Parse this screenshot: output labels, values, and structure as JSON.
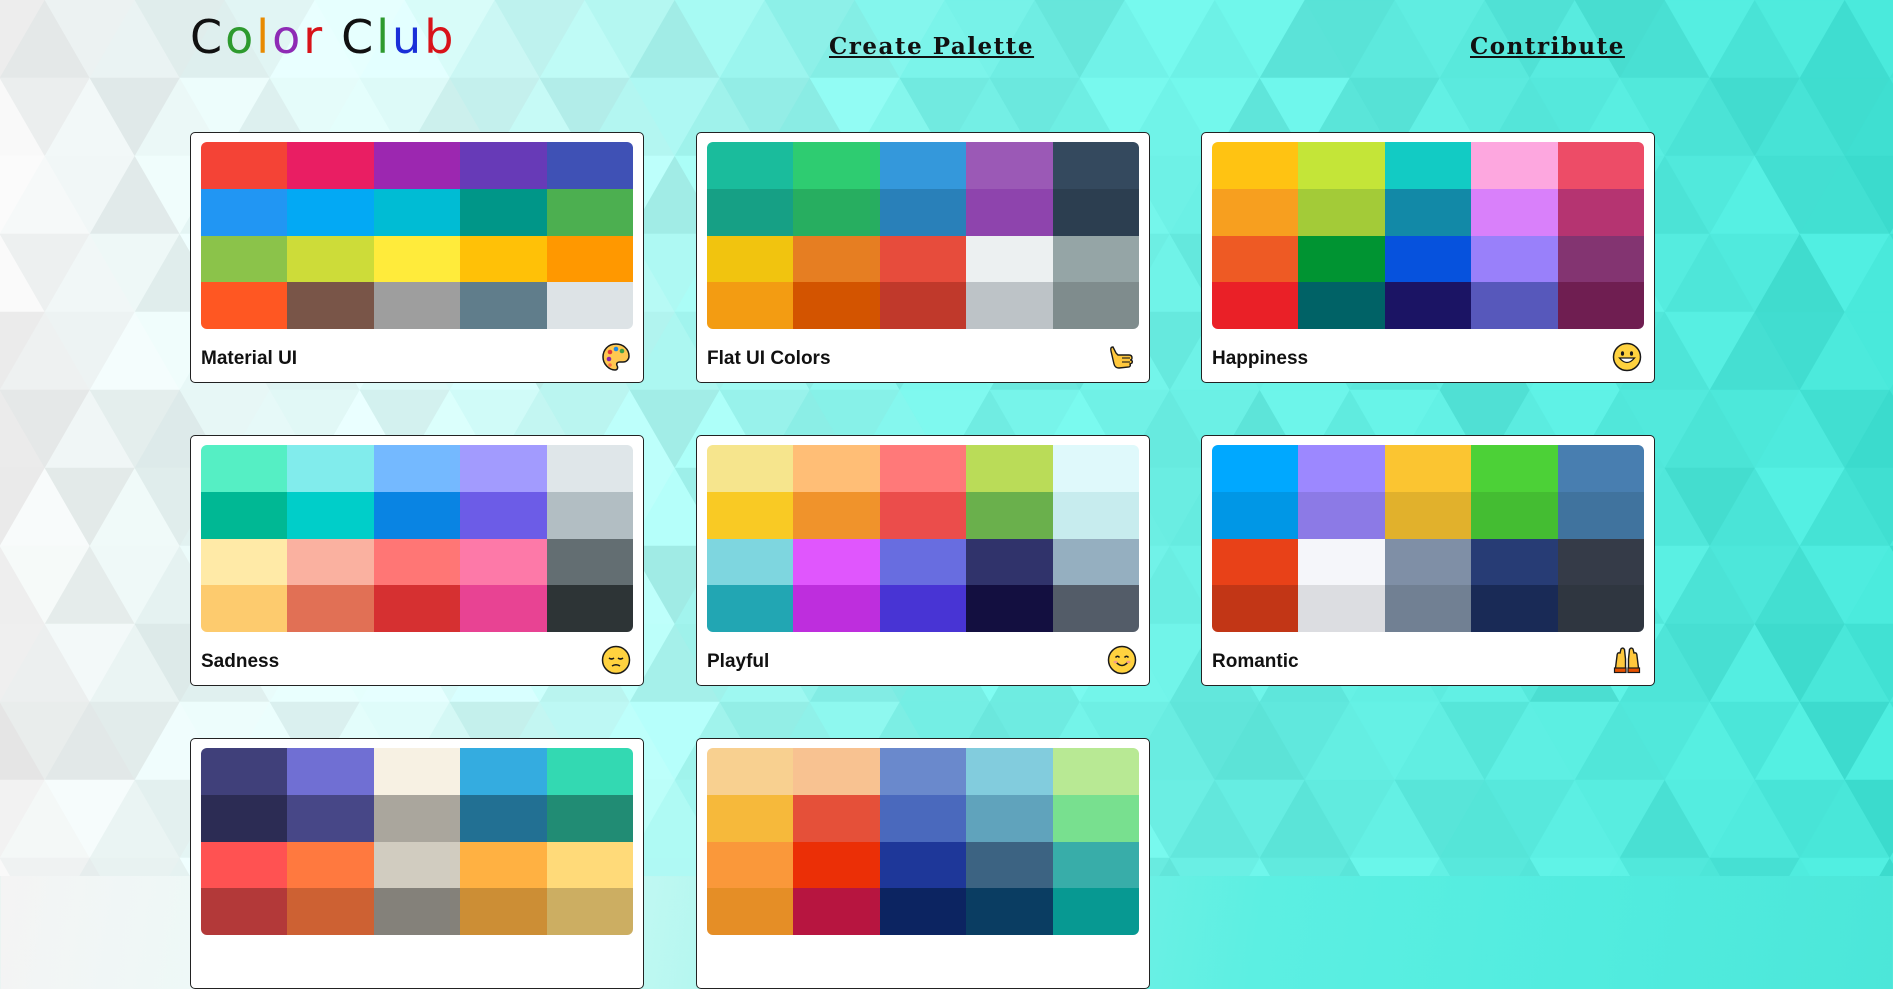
{
  "header": {
    "logo_letters": [
      {
        "char": "C",
        "color": "#111111"
      },
      {
        "char": "o",
        "color": "#2e9a2e"
      },
      {
        "char": "l",
        "color": "#e88a00"
      },
      {
        "char": "o",
        "color": "#8e2bb5"
      },
      {
        "char": "r",
        "color": "#d8131a"
      },
      {
        "char": " ",
        "color": "#111111"
      },
      {
        "char": "C",
        "color": "#111111"
      },
      {
        "char": "l",
        "color": "#2e9a2e"
      },
      {
        "char": "u",
        "color": "#1a2fd8"
      },
      {
        "char": "b",
        "color": "#d8131a"
      }
    ],
    "nav": {
      "create_palette": "Create Palette",
      "contribute": "Contribute"
    }
  },
  "palettes": [
    {
      "name": "Material UI",
      "icon": "artist-palette-icon",
      "colors": [
        "#F44336",
        "#E91E63",
        "#9C27B0",
        "#673AB7",
        "#3F51B5",
        "#2196F3",
        "#03A9F4",
        "#00BCD4",
        "#009688",
        "#4CAF50",
        "#8BC34A",
        "#CDDC39",
        "#FFEB3B",
        "#FFC107",
        "#FF9800",
        "#FF5722",
        "#795548",
        "#9E9E9E",
        "#607D8B",
        "#DDE3E6"
      ]
    },
    {
      "name": "Flat UI Colors",
      "icon": "call-me-hand-icon",
      "colors": [
        "#1ABC9C",
        "#2ECC71",
        "#3498DB",
        "#9B59B6",
        "#34495E",
        "#16A085",
        "#27AE60",
        "#2980B9",
        "#8E44AD",
        "#2C3E50",
        "#F1C40F",
        "#E67E22",
        "#E74C3C",
        "#ECF0F1",
        "#95A5A6",
        "#F39C12",
        "#D35400",
        "#C0392B",
        "#BDC3C7",
        "#7F8C8D"
      ]
    },
    {
      "name": "Happiness",
      "icon": "grinning-face-icon",
      "colors": [
        "#FFC312",
        "#C4E538",
        "#12CBC4",
        "#FDA7DF",
        "#ED4C67",
        "#F79F1F",
        "#A3CB38",
        "#1289A7",
        "#D980FA",
        "#B53471",
        "#EE5A24",
        "#009432",
        "#0652DD",
        "#9980FA",
        "#833471",
        "#EA2027",
        "#006266",
        "#1B1464",
        "#5758BB",
        "#6F1E51"
      ]
    },
    {
      "name": "Sadness",
      "icon": "pensive-face-icon",
      "colors": [
        "#55EFC4",
        "#81ECEC",
        "#74B9FF",
        "#A29BFE",
        "#DFE6E9",
        "#00B894",
        "#00CEC9",
        "#0984E3",
        "#6C5CE7",
        "#B2BEC3",
        "#FFEAA7",
        "#FAB1A0",
        "#FF7675",
        "#FD79A8",
        "#636E72",
        "#FDCB6E",
        "#E17055",
        "#D63031",
        "#E84393",
        "#2D3436"
      ]
    },
    {
      "name": "Playful",
      "icon": "smiling-face-icon",
      "colors": [
        "#F6E58D",
        "#FFBE76",
        "#FF7979",
        "#BADC58",
        "#DFF9FB",
        "#F9CA24",
        "#F0932B",
        "#EB4D4B",
        "#6AB04C",
        "#C7ECEE",
        "#7ED6DF",
        "#E056FD",
        "#686DE0",
        "#30336B",
        "#95AFC0",
        "#22A6B3",
        "#BE2EDD",
        "#4834D4",
        "#130F40",
        "#535C68"
      ]
    },
    {
      "name": "Romantic",
      "icon": "raising-hands-icon",
      "colors": [
        "#00A8FF",
        "#9C88FF",
        "#FBC531",
        "#4CD137",
        "#487EB0",
        "#0097E6",
        "#8C7AE6",
        "#E1B12C",
        "#44BD32",
        "#40739E",
        "#E84118",
        "#F5F6FA",
        "#7F8FA6",
        "#273C75",
        "#353B48",
        "#C23616",
        "#DCDDE1",
        "#718093",
        "#192A56",
        "#2F3640"
      ]
    },
    {
      "name": "",
      "icon": "",
      "colors": [
        "#40407A",
        "#706FD3",
        "#F7F1E3",
        "#34ACE0",
        "#33D9B2",
        "#2C2C54",
        "#474787",
        "#AAA69D",
        "#227093",
        "#218C74",
        "#FF5252",
        "#FF793F",
        "#D1CCC0",
        "#FFB142",
        "#FFDA79",
        "#B33939",
        "#CD6133",
        "#84817A",
        "#CC8E35",
        "#CCAE62"
      ]
    },
    {
      "name": "",
      "icon": "",
      "colors": [
        "#F8D090",
        "#F8C291",
        "#6A89CC",
        "#82CCDD",
        "#B8E994",
        "#F6B93B",
        "#E55039",
        "#4A69BD",
        "#60A3BC",
        "#78E08F",
        "#FA983A",
        "#EB2F06",
        "#1E3799",
        "#3C6382",
        "#38ADA9",
        "#E58E26",
        "#B71540",
        "#0C2461",
        "#0A3D62",
        "#079992"
      ]
    }
  ]
}
